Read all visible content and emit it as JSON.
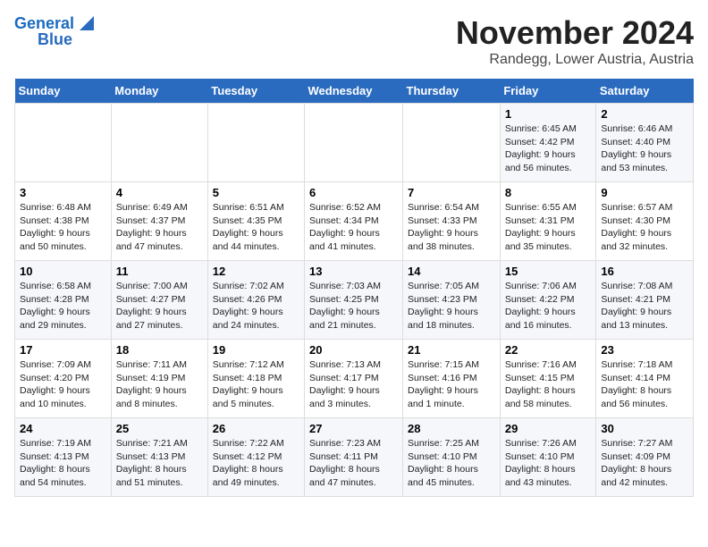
{
  "logo": {
    "line1": "General",
    "line2": "Blue"
  },
  "title": "November 2024",
  "subtitle": "Randegg, Lower Austria, Austria",
  "headers": [
    "Sunday",
    "Monday",
    "Tuesday",
    "Wednesday",
    "Thursday",
    "Friday",
    "Saturday"
  ],
  "weeks": [
    [
      {
        "num": "",
        "info": ""
      },
      {
        "num": "",
        "info": ""
      },
      {
        "num": "",
        "info": ""
      },
      {
        "num": "",
        "info": ""
      },
      {
        "num": "",
        "info": ""
      },
      {
        "num": "1",
        "info": "Sunrise: 6:45 AM\nSunset: 4:42 PM\nDaylight: 9 hours and 56 minutes."
      },
      {
        "num": "2",
        "info": "Sunrise: 6:46 AM\nSunset: 4:40 PM\nDaylight: 9 hours and 53 minutes."
      }
    ],
    [
      {
        "num": "3",
        "info": "Sunrise: 6:48 AM\nSunset: 4:38 PM\nDaylight: 9 hours and 50 minutes."
      },
      {
        "num": "4",
        "info": "Sunrise: 6:49 AM\nSunset: 4:37 PM\nDaylight: 9 hours and 47 minutes."
      },
      {
        "num": "5",
        "info": "Sunrise: 6:51 AM\nSunset: 4:35 PM\nDaylight: 9 hours and 44 minutes."
      },
      {
        "num": "6",
        "info": "Sunrise: 6:52 AM\nSunset: 4:34 PM\nDaylight: 9 hours and 41 minutes."
      },
      {
        "num": "7",
        "info": "Sunrise: 6:54 AM\nSunset: 4:33 PM\nDaylight: 9 hours and 38 minutes."
      },
      {
        "num": "8",
        "info": "Sunrise: 6:55 AM\nSunset: 4:31 PM\nDaylight: 9 hours and 35 minutes."
      },
      {
        "num": "9",
        "info": "Sunrise: 6:57 AM\nSunset: 4:30 PM\nDaylight: 9 hours and 32 minutes."
      }
    ],
    [
      {
        "num": "10",
        "info": "Sunrise: 6:58 AM\nSunset: 4:28 PM\nDaylight: 9 hours and 29 minutes."
      },
      {
        "num": "11",
        "info": "Sunrise: 7:00 AM\nSunset: 4:27 PM\nDaylight: 9 hours and 27 minutes."
      },
      {
        "num": "12",
        "info": "Sunrise: 7:02 AM\nSunset: 4:26 PM\nDaylight: 9 hours and 24 minutes."
      },
      {
        "num": "13",
        "info": "Sunrise: 7:03 AM\nSunset: 4:25 PM\nDaylight: 9 hours and 21 minutes."
      },
      {
        "num": "14",
        "info": "Sunrise: 7:05 AM\nSunset: 4:23 PM\nDaylight: 9 hours and 18 minutes."
      },
      {
        "num": "15",
        "info": "Sunrise: 7:06 AM\nSunset: 4:22 PM\nDaylight: 9 hours and 16 minutes."
      },
      {
        "num": "16",
        "info": "Sunrise: 7:08 AM\nSunset: 4:21 PM\nDaylight: 9 hours and 13 minutes."
      }
    ],
    [
      {
        "num": "17",
        "info": "Sunrise: 7:09 AM\nSunset: 4:20 PM\nDaylight: 9 hours and 10 minutes."
      },
      {
        "num": "18",
        "info": "Sunrise: 7:11 AM\nSunset: 4:19 PM\nDaylight: 9 hours and 8 minutes."
      },
      {
        "num": "19",
        "info": "Sunrise: 7:12 AM\nSunset: 4:18 PM\nDaylight: 9 hours and 5 minutes."
      },
      {
        "num": "20",
        "info": "Sunrise: 7:13 AM\nSunset: 4:17 PM\nDaylight: 9 hours and 3 minutes."
      },
      {
        "num": "21",
        "info": "Sunrise: 7:15 AM\nSunset: 4:16 PM\nDaylight: 9 hours and 1 minute."
      },
      {
        "num": "22",
        "info": "Sunrise: 7:16 AM\nSunset: 4:15 PM\nDaylight: 8 hours and 58 minutes."
      },
      {
        "num": "23",
        "info": "Sunrise: 7:18 AM\nSunset: 4:14 PM\nDaylight: 8 hours and 56 minutes."
      }
    ],
    [
      {
        "num": "24",
        "info": "Sunrise: 7:19 AM\nSunset: 4:13 PM\nDaylight: 8 hours and 54 minutes."
      },
      {
        "num": "25",
        "info": "Sunrise: 7:21 AM\nSunset: 4:13 PM\nDaylight: 8 hours and 51 minutes."
      },
      {
        "num": "26",
        "info": "Sunrise: 7:22 AM\nSunset: 4:12 PM\nDaylight: 8 hours and 49 minutes."
      },
      {
        "num": "27",
        "info": "Sunrise: 7:23 AM\nSunset: 4:11 PM\nDaylight: 8 hours and 47 minutes."
      },
      {
        "num": "28",
        "info": "Sunrise: 7:25 AM\nSunset: 4:10 PM\nDaylight: 8 hours and 45 minutes."
      },
      {
        "num": "29",
        "info": "Sunrise: 7:26 AM\nSunset: 4:10 PM\nDaylight: 8 hours and 43 minutes."
      },
      {
        "num": "30",
        "info": "Sunrise: 7:27 AM\nSunset: 4:09 PM\nDaylight: 8 hours and 42 minutes."
      }
    ]
  ]
}
